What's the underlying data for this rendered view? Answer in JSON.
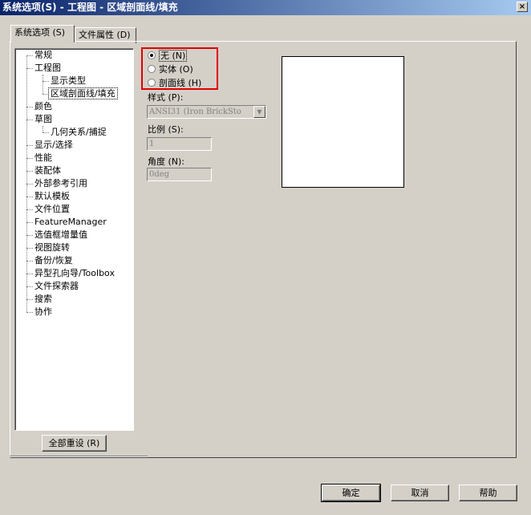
{
  "window": {
    "title": "系统选项(S) - 工程图 - 区域剖面线/填充",
    "close_label": "×"
  },
  "tabs": [
    {
      "label": "系统选项 (S)"
    },
    {
      "label": "文件属性 (D)"
    }
  ],
  "tree": {
    "items": [
      {
        "label": "常规"
      },
      {
        "label": "工程图"
      },
      {
        "label": "显示类型"
      },
      {
        "label": "区域剖面线/填充"
      },
      {
        "label": "颜色"
      },
      {
        "label": "草图"
      },
      {
        "label": "几何关系/捕捉"
      },
      {
        "label": "显示/选择"
      },
      {
        "label": "性能"
      },
      {
        "label": "装配体"
      },
      {
        "label": "外部参考引用"
      },
      {
        "label": "默认模板"
      },
      {
        "label": "文件位置"
      },
      {
        "label": "FeatureManager"
      },
      {
        "label": "选值框增量值"
      },
      {
        "label": "视图旋转"
      },
      {
        "label": "备份/恢复"
      },
      {
        "label": "异型孔向导/Toolbox"
      },
      {
        "label": "文件探索器"
      },
      {
        "label": "搜索"
      },
      {
        "label": "协作"
      }
    ]
  },
  "options": {
    "radios": [
      {
        "label": "无 (N)",
        "checked": true
      },
      {
        "label": "实体 (O)",
        "checked": false
      },
      {
        "label": "剖面线 (H)",
        "checked": false
      }
    ],
    "style_label": "样式 (P):",
    "style_value": "ANSI31 (Iron BrickSto",
    "scale_label": "比例 (S):",
    "scale_value": "1",
    "angle_label": "角度 (N):",
    "angle_value": "0deg"
  },
  "buttons": {
    "reset_all": "全部重设 (R)",
    "ok": "确定",
    "cancel": "取消",
    "help": "帮助"
  },
  "colors": {
    "highlight": "#e00000",
    "titlebar": "#0a246a"
  }
}
